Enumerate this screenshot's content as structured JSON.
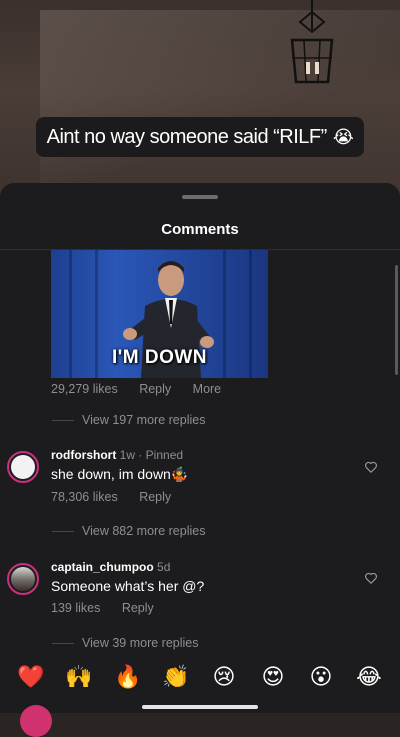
{
  "caption": {
    "text": "Aint no way someone said “RILF”",
    "emoji": "😭"
  },
  "sheet": {
    "title": "Comments"
  },
  "gif_comment": {
    "gif_text": "I'M DOWN",
    "likes": "29,279 likes",
    "reply_label": "Reply",
    "more_label": "More",
    "view_replies": "View 197 more replies"
  },
  "comments": [
    {
      "username": "rodforshort",
      "meta": "1w · Pinned",
      "text": "she down, im down",
      "text_emoji": "🤹",
      "likes": "78,306 likes",
      "reply_label": "Reply",
      "view_replies": "View 882 more replies"
    },
    {
      "username": "captain_chumpoo",
      "meta": "5d",
      "text": "Someone what’s her @?",
      "likes": "139 likes",
      "reply_label": "Reply",
      "view_replies": "View 39 more replies"
    }
  ],
  "quick_emojis": [
    "❤️",
    "🙌",
    "🔥",
    "👏",
    "😢",
    "😍",
    "😮",
    "😂"
  ],
  "icons": {
    "heart": "heart-outline-icon",
    "lamp": "pendant-lamp"
  },
  "colors": {
    "sheet_bg": "#1c1c1e",
    "secondary_text": "#8e8e93",
    "story_ring": "#c9317e"
  }
}
